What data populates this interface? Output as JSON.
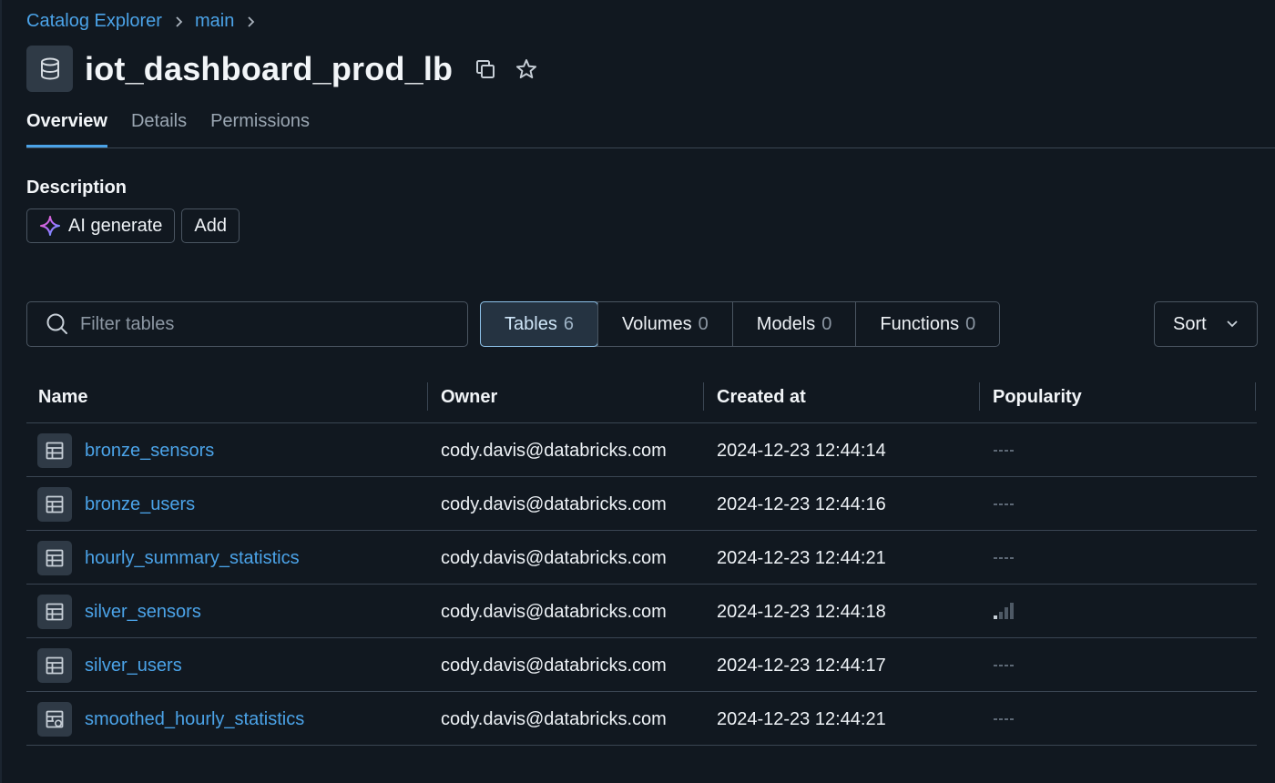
{
  "breadcrumb": {
    "root": "Catalog Explorer",
    "catalog": "main"
  },
  "header": {
    "title": "iot_dashboard_prod_lb"
  },
  "tabs": [
    {
      "label": "Overview",
      "active": true
    },
    {
      "label": "Details",
      "active": false
    },
    {
      "label": "Permissions",
      "active": false
    }
  ],
  "description": {
    "label": "Description",
    "ai_generate": "AI generate",
    "add": "Add"
  },
  "filter": {
    "placeholder": "Filter tables"
  },
  "segments": [
    {
      "label": "Tables",
      "count": "6",
      "active": true
    },
    {
      "label": "Volumes",
      "count": "0",
      "active": false
    },
    {
      "label": "Models",
      "count": "0",
      "active": false
    },
    {
      "label": "Functions",
      "count": "0",
      "active": false
    }
  ],
  "sort": {
    "label": "Sort"
  },
  "table": {
    "columns": [
      "Name",
      "Owner",
      "Created at",
      "Popularity"
    ],
    "rows": [
      {
        "name": "bronze_sensors",
        "owner": "cody.davis@databricks.com",
        "created": "2024-12-23 12:44:14",
        "icon": "table-icon",
        "popularity": 0
      },
      {
        "name": "bronze_users",
        "owner": "cody.davis@databricks.com",
        "created": "2024-12-23 12:44:16",
        "icon": "table-icon",
        "popularity": 0
      },
      {
        "name": "hourly_summary_statistics",
        "owner": "cody.davis@databricks.com",
        "created": "2024-12-23 12:44:21",
        "icon": "table-icon",
        "popularity": 0
      },
      {
        "name": "silver_sensors",
        "owner": "cody.davis@databricks.com",
        "created": "2024-12-23 12:44:18",
        "icon": "table-icon",
        "popularity": 1
      },
      {
        "name": "silver_users",
        "owner": "cody.davis@databricks.com",
        "created": "2024-12-23 12:44:17",
        "icon": "table-icon",
        "popularity": 0
      },
      {
        "name": "smoothed_hourly_statistics",
        "owner": "cody.davis@databricks.com",
        "created": "2024-12-23 12:44:21",
        "icon": "materialized-view-icon",
        "popularity": 0
      }
    ]
  },
  "colors": {
    "accent": "#4ba3e8",
    "background": "#111820",
    "border": "#4a5561"
  }
}
